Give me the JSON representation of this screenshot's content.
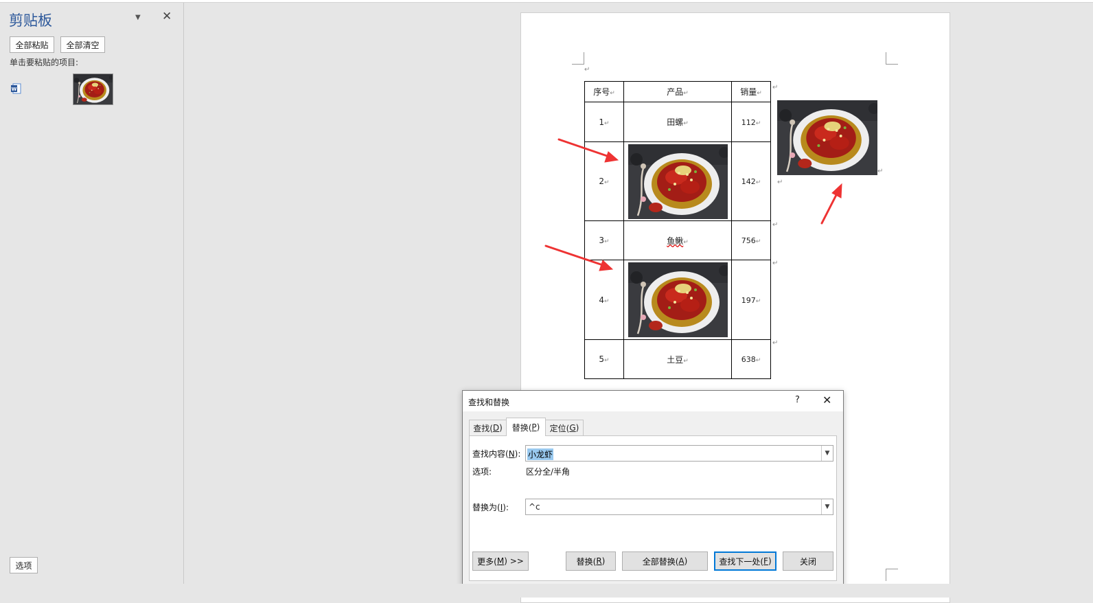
{
  "clipboard": {
    "title": "剪贴板",
    "paste_all": "全部粘贴",
    "clear_all": "全部清空",
    "hint": "单击要粘贴的项目:",
    "options": "选项"
  },
  "table": {
    "headers": [
      "序号",
      "产品",
      "销量"
    ],
    "rows": [
      {
        "num": "1",
        "product": "田螺",
        "sales": "112"
      },
      {
        "num": "2",
        "product": "",
        "sales": "142"
      },
      {
        "num": "3",
        "product": "鱼鳅",
        "sales": "756"
      },
      {
        "num": "4",
        "product": "",
        "sales": "197"
      },
      {
        "num": "5",
        "product": "土豆",
        "sales": "638"
      }
    ],
    "para_mark": "↵"
  },
  "dialog": {
    "title": "查找和替换",
    "help": "?",
    "close_x": "✕",
    "tabs": {
      "find": "查找(D)",
      "replace": "替换(P)",
      "goto": "定位(G)"
    },
    "find_label": "查找内容(N):",
    "find_value": "小龙虾",
    "options_label": "选项:",
    "options_value": "区分全/半角",
    "replace_label": "替换为(I):",
    "replace_value": "^c",
    "buttons": {
      "more": "更多(M) >>",
      "replace": "替换(R)",
      "replace_all": "全部替换(A)",
      "find_next": "查找下一处(F)",
      "close": "关闭"
    }
  },
  "colors": {
    "accent": "#2b579a",
    "arrow": "#ee3333",
    "selection": "#99c9ef"
  }
}
